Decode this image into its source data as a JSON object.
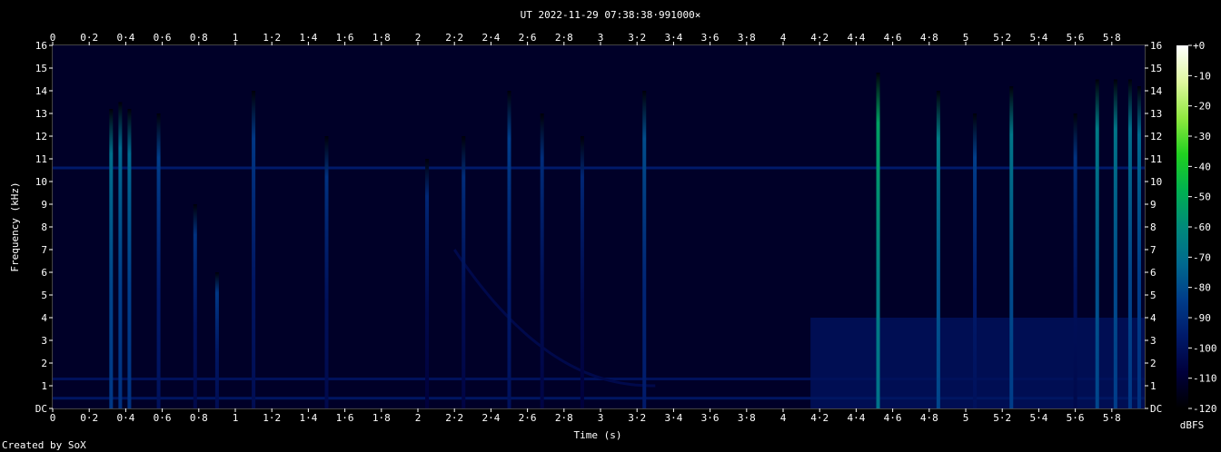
{
  "chart_data": {
    "type": "heatmap",
    "title": "UT 2022-11-29 07:38:38·991000×",
    "xlabel": "Time (s)",
    "ylabel": "Frequency (kHz)",
    "colorbar_label": "dBFS",
    "credit": "Created by SoX",
    "xlim": [
      0,
      5.98
    ],
    "ylim": [
      0,
      16
    ],
    "x_ticks": [
      "0",
      "0·2",
      "0·4",
      "0·6",
      "0·8",
      "1",
      "1·2",
      "1·4",
      "1·6",
      "1·8",
      "2",
      "2·2",
      "2·4",
      "2·6",
      "2·8",
      "3",
      "3·2",
      "3·4",
      "3·6",
      "3·8",
      "4",
      "4·2",
      "4·4",
      "4·6",
      "4·8",
      "5",
      "5·2",
      "5·4",
      "5·6",
      "5·8"
    ],
    "x_tick_values": [
      0,
      0.2,
      0.4,
      0.6,
      0.8,
      1,
      1.2,
      1.4,
      1.6,
      1.8,
      2,
      2.2,
      2.4,
      2.6,
      2.8,
      3,
      3.2,
      3.4,
      3.6,
      3.8,
      4,
      4.2,
      4.4,
      4.6,
      4.8,
      5,
      5.2,
      5.4,
      5.6,
      5.8
    ],
    "y_ticks": [
      "DC",
      "1",
      "2",
      "3",
      "4",
      "5",
      "6",
      "7",
      "8",
      "9",
      "10",
      "11",
      "12",
      "13",
      "14",
      "15",
      "16"
    ],
    "y_tick_values": [
      0,
      1,
      2,
      3,
      4,
      5,
      6,
      7,
      8,
      9,
      10,
      11,
      12,
      13,
      14,
      15,
      16
    ],
    "colorbar_ticks": [
      "+0",
      "-10",
      "-20",
      "-30",
      "-40",
      "-50",
      "-60",
      "-70",
      "-80",
      "-90",
      "-100",
      "-110",
      "-120"
    ],
    "colorbar_values": [
      0,
      -10,
      -20,
      -30,
      -40,
      -50,
      -60,
      -70,
      -80,
      -90,
      -100,
      -110,
      -120
    ],
    "colorbar_range": [
      -120,
      0
    ],
    "colorbar_colors": [
      "#000000",
      "#00003c",
      "#001a6a",
      "#003d8a",
      "#006a8e",
      "#008a7a",
      "#00b050",
      "#20d020",
      "#90e840",
      "#e0f8a0",
      "#ffffff"
    ],
    "background_level_dbfs": -112,
    "tonal_lines": [
      {
        "freq_khz": 10.6,
        "t_start": 0.0,
        "t_end": 5.98,
        "level_dbfs": -96
      },
      {
        "freq_khz": 1.3,
        "t_start": 0.0,
        "t_end": 5.98,
        "level_dbfs": -100
      },
      {
        "freq_khz": 0.45,
        "t_start": 0.0,
        "t_end": 5.98,
        "level_dbfs": -98
      }
    ],
    "sweep": {
      "t_start": 2.2,
      "t_end": 3.3,
      "f_start_khz": 7.0,
      "f_end_khz": 1.0,
      "level_dbfs": -104
    },
    "broadband_region": {
      "t_start": 4.15,
      "t_end": 5.98,
      "f_max_khz": 4.0,
      "level_dbfs": -100
    },
    "transients": [
      {
        "t": 0.32,
        "f_max_khz": 13.2,
        "level_dbfs": -82
      },
      {
        "t": 0.37,
        "f_max_khz": 13.5,
        "level_dbfs": -84
      },
      {
        "t": 0.42,
        "f_max_khz": 13.2,
        "level_dbfs": -84
      },
      {
        "t": 0.58,
        "f_max_khz": 13.0,
        "level_dbfs": -96
      },
      {
        "t": 0.78,
        "f_max_khz": 9.0,
        "level_dbfs": -100
      },
      {
        "t": 0.9,
        "f_max_khz": 6.0,
        "level_dbfs": -98
      },
      {
        "t": 1.1,
        "f_max_khz": 14.0,
        "level_dbfs": -98
      },
      {
        "t": 1.5,
        "f_max_khz": 12.0,
        "level_dbfs": -100
      },
      {
        "t": 2.05,
        "f_max_khz": 11.0,
        "level_dbfs": -104
      },
      {
        "t": 2.25,
        "f_max_khz": 12.0,
        "level_dbfs": -102
      },
      {
        "t": 2.5,
        "f_max_khz": 14.0,
        "level_dbfs": -96
      },
      {
        "t": 2.68,
        "f_max_khz": 13.0,
        "level_dbfs": -102
      },
      {
        "t": 2.9,
        "f_max_khz": 12.0,
        "level_dbfs": -104
      },
      {
        "t": 3.24,
        "f_max_khz": 14.0,
        "level_dbfs": -92
      },
      {
        "t": 4.52,
        "f_max_khz": 14.8,
        "level_dbfs": -65
      },
      {
        "t": 4.85,
        "f_max_khz": 14.0,
        "level_dbfs": -78
      },
      {
        "t": 5.05,
        "f_max_khz": 13.0,
        "level_dbfs": -96
      },
      {
        "t": 5.25,
        "f_max_khz": 14.2,
        "level_dbfs": -80
      },
      {
        "t": 5.6,
        "f_max_khz": 13.0,
        "level_dbfs": -100
      },
      {
        "t": 5.72,
        "f_max_khz": 14.5,
        "level_dbfs": -78
      },
      {
        "t": 5.82,
        "f_max_khz": 14.5,
        "level_dbfs": -80
      },
      {
        "t": 5.9,
        "f_max_khz": 14.5,
        "level_dbfs": -82
      },
      {
        "t": 5.95,
        "f_max_khz": 14.2,
        "level_dbfs": -84
      }
    ]
  }
}
